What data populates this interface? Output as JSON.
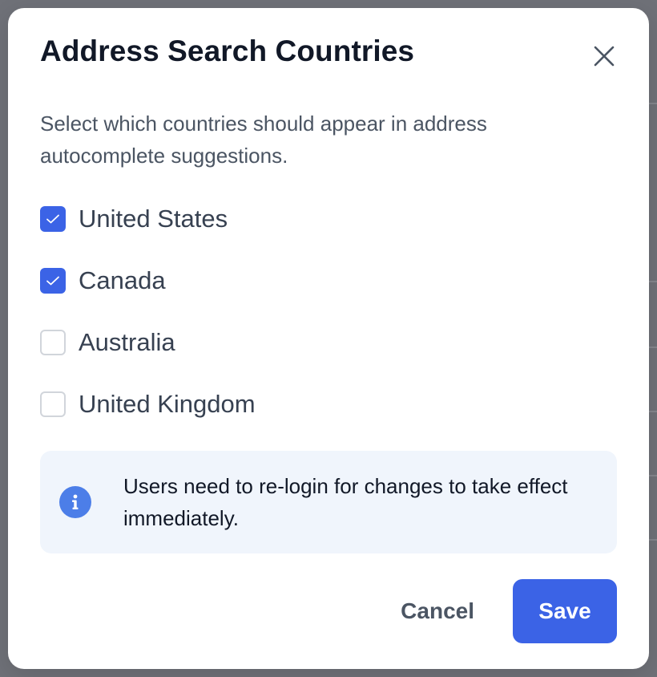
{
  "dialog": {
    "title": "Address Search Countries",
    "close_icon": "close-icon",
    "description": "Select which countries should appear in address autocomplete suggestions.",
    "options": [
      {
        "label": "United States",
        "checked": true
      },
      {
        "label": "Canada",
        "checked": true
      },
      {
        "label": "Australia",
        "checked": false
      },
      {
        "label": "United Kingdom",
        "checked": false
      }
    ],
    "info": {
      "icon": "info-icon",
      "text": "Users need to re-login for changes to take effect immediately."
    },
    "footer": {
      "cancel_label": "Cancel",
      "save_label": "Save"
    }
  },
  "colors": {
    "accent": "#3b63e6",
    "info_bg": "#f0f5fc",
    "info_icon": "#4c7ee8",
    "backdrop": "#6f7178"
  }
}
